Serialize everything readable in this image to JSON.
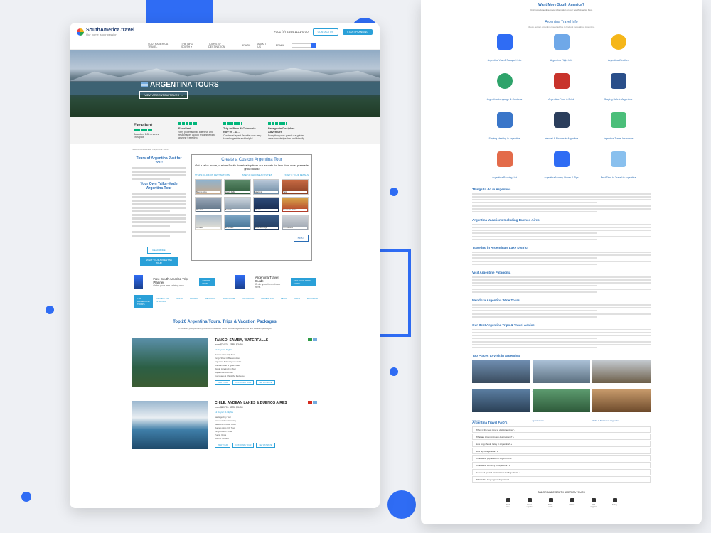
{
  "left": {
    "logo_title": "SouthAmerica.travel",
    "logo_sub": "Our home is our passion",
    "phone": "+001 (0) 4444 1111-0 00",
    "btn_contact": "CONTACT US",
    "btn_enquire": "START PLANNING",
    "nav": [
      "SOUTHAMERICA TRAVEL",
      "THE INFO SOUTH ▾",
      "TOURS BY DESTINATION",
      "BRAZIL",
      "ABOUT US",
      "BRAZIL"
    ],
    "search_label": "Search",
    "hero_title": "ARGENTINA TOURS",
    "hero_btn": "VIEW ARGENTINA TOURS →",
    "reviews": [
      {
        "t": "Excellent",
        "s": "Based on 1.8k reviews"
      },
      {
        "t": "Excellent",
        "s": "Very professional, attentive and responsive. Would recommend to anyone travelling."
      },
      {
        "t": "Trip to Peru & Colombia - Nov 09 - D...",
        "s": "Our travel agent Jennifer was very knowledgeable and helpful."
      },
      {
        "t": "Patagonia Decipher Adventure",
        "s": "Everything was great, our guides were knowledgeable and friendly."
      }
    ],
    "trustpilot": "Trustpilot",
    "breadcrumb": "SouthAmerica.travel  ›  Argentina Tours",
    "intro_h1": "Tours of Argentina Just for You!",
    "intro_h2": "Your Own Tailor-Made Argentina Tour",
    "form_title": "Create a Custom Argentina Tour",
    "form_sub": "Get a tailor-made, custom South America trip from our experts for less than most premade group tours!",
    "steps": [
      "STEP 1: CLICK ON DESTINATIONS",
      "STEP 2: CHOOSE ACTIVITIES",
      "STEP 3: TOUR DETAILS"
    ],
    "tiles": [
      "Buenos Aires",
      "Iguazu Falls",
      "Patagonia",
      "Salta",
      "Mendoza",
      "Bariloche",
      "Ushuaia",
      "Peninsula Valdes",
      "Cordoba",
      "El Chalten",
      "Tierra del Fuego",
      "I'm Not Sure"
    ],
    "next_btn": "NEXT",
    "btn_read": "READ MORE",
    "btn_start": "START YOUR ARGENTINA TOUR",
    "promo1_t": "Free South America Trip Planner",
    "promo1_s": "Order your free catalog now.",
    "promo1_b": "ORDER NOW",
    "promo2_t": "Argentina Travel Guide",
    "promo2_s": "Order your free e-book here.",
    "promo2_b": "GET YOUR FREE GUIDE",
    "tabs": [
      "TOP ARGENTINA TOURS",
      "ARGENTINA & BRAZIL",
      "SALTA",
      "IGUAZU",
      "MENDOZA",
      "BARILOCHE",
      "PATAGONIA",
      "ARGENTINA",
      "PERU",
      "CHILE",
      "ECUADOR"
    ],
    "top20_title": "Top 20 Argentina Tours, Trips & Vacation Packages",
    "top20_sub": "To kickstart your planning process, browse our list of popular Argentina trips and vacation packages.",
    "packages": [
      {
        "title": "TANGO, SAMBA, WATERFALLS",
        "price": "from $2470 - $5RL $3450",
        "days": "10 Days / 9 Nights",
        "items": [
          "Buenos Aires City Tour",
          "Tango Show in Buenos Aires",
          "Argentine Side of Iguazu Falls",
          "Brazilian Side of Iguazu Falls",
          "Rio de Janeiro City Tour",
          "Sugar Loaf Mountain",
          "Corcovado & Christ the Redeemer"
        ],
        "btns": [
          "VIEW TOUR",
          "CUSTOMIZE TOUR",
          "GET ESTIMATE"
        ]
      },
      {
        "title": "CHILE, ANDEAN LAKES & BUENOS AIRES",
        "price": "from $2970 - $5RL $3450",
        "days": "12 Days / 11 Nights",
        "items": [
          "Santiago City Tour",
          "Andean Lakes Crossing",
          "Bariloche Circuito Chico",
          "Buenos Aires City Tour",
          "Tango Dinner Show",
          "Puerto Varas",
          "Osorno Volcano"
        ],
        "btns": [
          "VIEW TOUR",
          "CUSTOMIZE TOUR",
          "GET ESTIMATE"
        ]
      }
    ]
  },
  "right": {
    "top_title": "Want More South America?",
    "top_sub": "Find more Argentina travel information on our South America blog.",
    "info_h": "Argentina Travel Info",
    "info_s": "Check out our Argentina travel advice to find out more about Argentina.",
    "icons": [
      "Argentina Visa & Passport Info",
      "Argentina Flight Info",
      "Argentina Weather",
      "Argentina Language & Customs",
      "Argentina Food & Drink",
      "Staying Safe in Argentina",
      "Staying Healthy in Argentina",
      "Internet & Phones in Argentina",
      "Argentina Travel Insurance",
      "Argentina Packing List",
      "Argentina Money, Prices & Tips",
      "Best Time to Travel to Argentina"
    ],
    "sections": [
      "Things to do in Argentina",
      "Argentina Vacations Including Buenos Aires",
      "Traveling in Argentina's Lake District",
      "Visit Argentine Patagonia",
      "Mendoza Argentina Wine Tours",
      "Our Best Argentina Trips & Travel Advice",
      "Top Places to Visit in Argentina"
    ],
    "places": [
      "Buenos Aires",
      "Bariloche & the Lake District",
      "Mendoza",
      "Ushuaia",
      "Iguazu Falls",
      "Salta & Northwest Argentina"
    ],
    "faq_h": "Argentina Travel FAQ's",
    "faqs": [
      "When is the best time to visit Argentina? +",
      "What are Argentina's top destinations? +",
      "How long should I stay in Argentina? +",
      "How big is Argentina? +",
      "What is the population of Argentina? +",
      "What is the currency of Argentina? +",
      "Do I need special vaccinations for Argentina? +",
      "What is the language of Argentina? +"
    ],
    "tm_title": "TAILOR-MADE SOUTH AMERICA TOURS",
    "tm_items": [
      "Hand-picked",
      "Local experts",
      "Tailor-made",
      "Private",
      "24/7 support",
      "Safety"
    ]
  }
}
